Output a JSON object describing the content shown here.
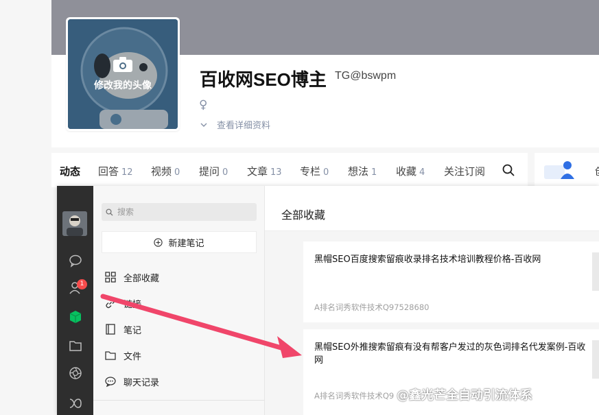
{
  "profile": {
    "avatar_hint": "修改我的头像",
    "name": "百收网SEO博主",
    "handle": "TG@bswpm",
    "gender_symbol": "♀",
    "detail_link": "查看详细资料"
  },
  "tabs": [
    {
      "label": "动态",
      "count": "",
      "active": true
    },
    {
      "label": "回答",
      "count": "12"
    },
    {
      "label": "视频",
      "count": "0"
    },
    {
      "label": "提问",
      "count": "0"
    },
    {
      "label": "文章",
      "count": "13"
    },
    {
      "label": "专栏",
      "count": "0"
    },
    {
      "label": "想法",
      "count": "1"
    },
    {
      "label": "收藏",
      "count": "4"
    },
    {
      "label": "关注订阅",
      "count": ""
    }
  ],
  "side_card": {
    "label": "创"
  },
  "app": {
    "rail": {
      "badge_count": "1"
    },
    "search": {
      "placeholder": "搜索"
    },
    "new_note_label": "新建笔记",
    "nav": [
      {
        "label": "全部收藏"
      },
      {
        "label": "链接"
      },
      {
        "label": "笔记"
      },
      {
        "label": "文件"
      },
      {
        "label": "聊天记录"
      }
    ],
    "content_title": "全部收藏",
    "cards": [
      {
        "title": "黑帽SEO百度搜索留痕收录排名技术培训教程价格-百收网",
        "source": "A排名词秀软件技术Q97528680"
      },
      {
        "title": "黑帽SEO外推搜索留痕有没有帮客户发过的灰色词排名代发案例-百收网",
        "source": "A排名词秀软件技术Q9"
      }
    ]
  },
  "watermark": "@鑫光芒全自动引流体系",
  "colors": {
    "cover": "#8f9099",
    "rail": "#2e2e2e",
    "accent_green": "#07c160",
    "arrow": "#f0466a",
    "badge": "#f74c4c"
  }
}
